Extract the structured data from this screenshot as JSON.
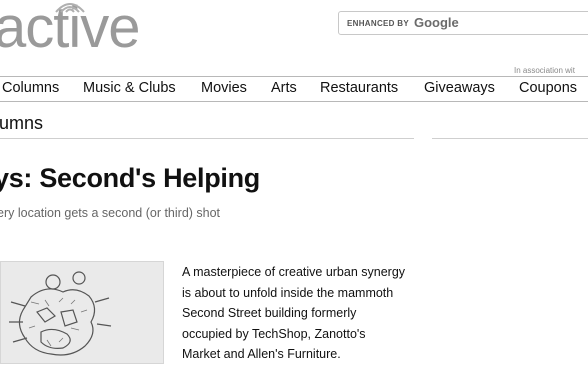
{
  "header": {
    "logo_text": "active",
    "search_enhanced": "ENHANCED BY",
    "search_google": "Google",
    "association": "In association wit"
  },
  "nav": {
    "items": [
      "Columns",
      "Music & Clubs",
      "Movies",
      "Arts",
      "Restaurants",
      "Giveaways",
      "Coupons"
    ]
  },
  "section": {
    "title": "umns"
  },
  "article": {
    "headline": "ys: Second's Helping",
    "deck": "ery location gets a second (or third) shot",
    "body_lines": [
      "A masterpiece of creative urban synergy",
      "is about to unfold inside the mammoth",
      "Second Street building formerly",
      "occupied by TechShop, Zanotto's",
      "Market and Allen's Furniture."
    ]
  },
  "colors": {
    "logo": "#9a9a9a",
    "rule": "#b8b8b8",
    "deck": "#666666"
  }
}
